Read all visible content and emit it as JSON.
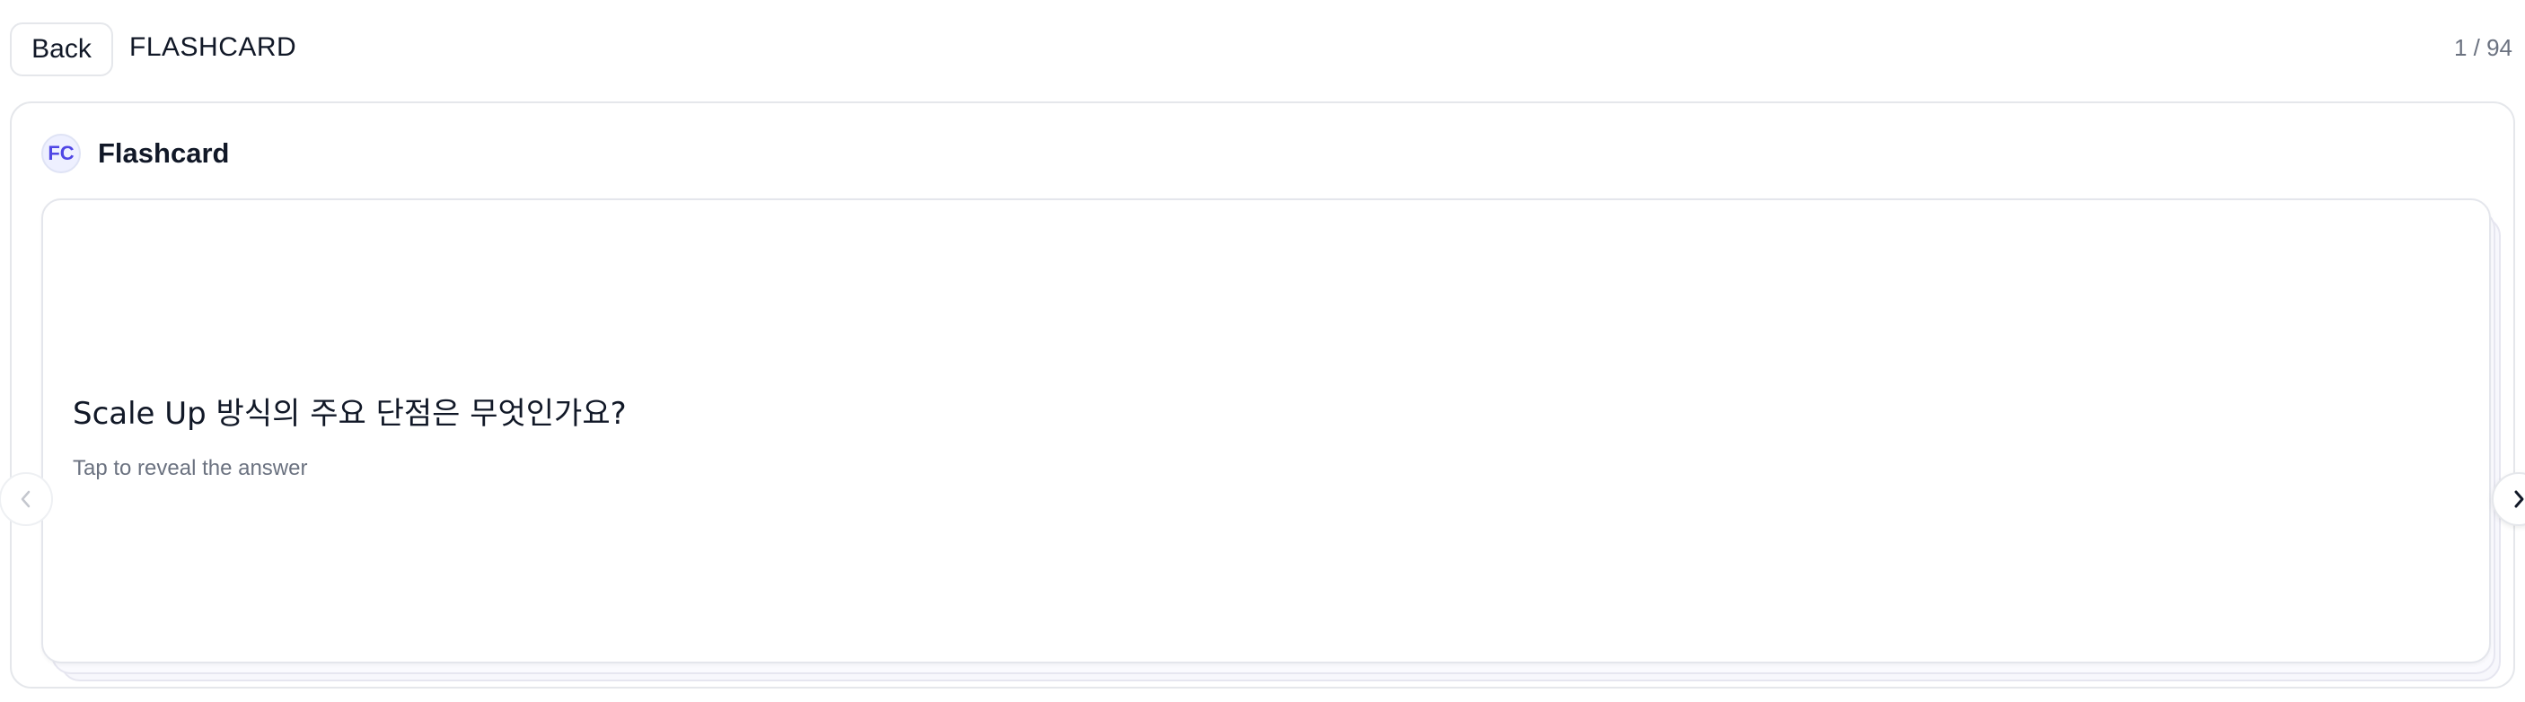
{
  "header": {
    "back_label": "Back",
    "title": "FLASHCARD",
    "counter": "1 / 94"
  },
  "deck": {
    "avatar_initials": "FC",
    "title": "Flashcard"
  },
  "card": {
    "question": "Scale Up 방식의 주요 단점은 무엇인가요?",
    "hint": "Tap to reveal the answer"
  },
  "nav": {
    "prev_icon": "chevron-left-icon",
    "next_icon": "chevron-right-icon"
  },
  "colors": {
    "accent": "#4f46e5",
    "border": "#e5e7eb",
    "muted_text": "#6b7280"
  }
}
